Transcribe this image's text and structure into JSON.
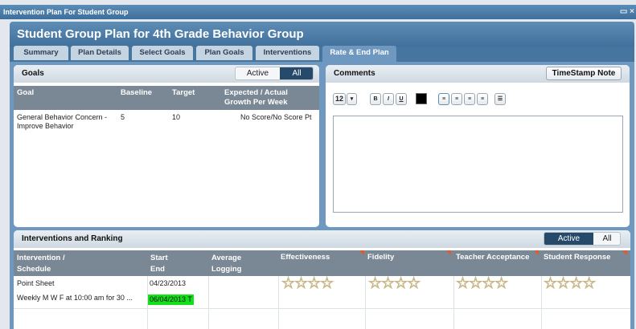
{
  "window": {
    "title": "Intervention Plan For Student Group",
    "controls": "▭ ×"
  },
  "header": {
    "title": "Student Group Plan for 4th Grade Behavior Group"
  },
  "tabs": [
    {
      "label": "Summary"
    },
    {
      "label": "Plan Details"
    },
    {
      "label": "Select Goals"
    },
    {
      "label": "Plan Goals"
    },
    {
      "label": "Interventions"
    },
    {
      "label": "Rate & End Plan"
    }
  ],
  "goals": {
    "title": "Goals",
    "filter": {
      "active": "Active",
      "all": "All",
      "selected": "All"
    },
    "columns": {
      "goal": "Goal",
      "baseline": "Baseline",
      "target": "Target",
      "growth": "Expected / Actual Growth Per Week"
    },
    "rows": [
      {
        "goal": "General Behavior Concern - Improve Behavior",
        "baseline": "5",
        "target": "10",
        "growth": "No Score/No Score  Pt"
      }
    ]
  },
  "comments": {
    "title": "Comments",
    "timestamp_button": "TimeStamp Note",
    "font_size": "12",
    "toolbar": {
      "bold": "B",
      "italic": "I",
      "underline": "U"
    },
    "text_color": "#000000"
  },
  "interventions": {
    "title": "Interventions and Ranking",
    "filter": {
      "active": "Active",
      "all": "All",
      "selected": "Active"
    },
    "columns": {
      "intervention": "Intervention / Schedule",
      "start_end": "Start End",
      "avg_logging": "Average Logging",
      "effectiveness": "Effectiveness",
      "fidelity": "Fidelity",
      "teacher_acceptance": "Teacher Acceptance",
      "student_response": "Student Response"
    },
    "rows": [
      {
        "intervention": "Point Sheet",
        "schedule": "Weekly M W F at 10:00 am for 30 ...",
        "start": "04/23/2013",
        "end": "06/04/2013 T",
        "ratings": {
          "effectiveness": 0,
          "fidelity": 0,
          "teacher_acceptance": 0,
          "student_response": 0
        },
        "max_rating": 4
      }
    ]
  },
  "colors": {
    "header_blue": "#41719c",
    "highlight_green": "#11e01a",
    "dark_toggle": "#27496a"
  }
}
